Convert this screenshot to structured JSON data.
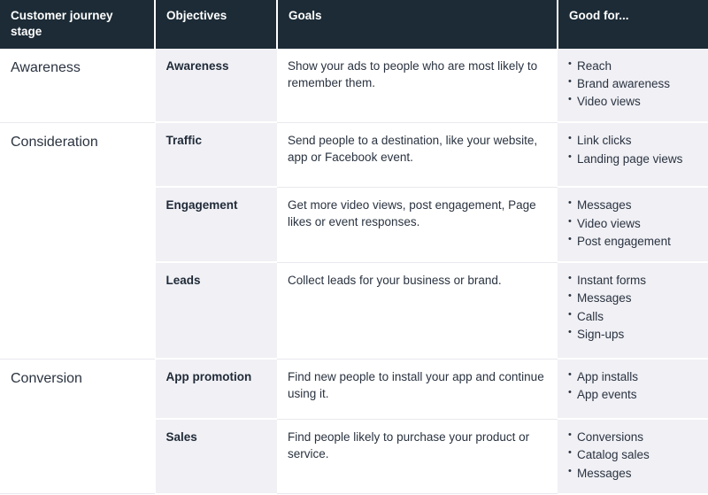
{
  "table": {
    "headers": [
      {
        "label": "Customer journey stage",
        "name": "header-customer-journey-stage"
      },
      {
        "label": "Objectives",
        "name": "header-objectives"
      },
      {
        "label": "Goals",
        "name": "header-goals"
      },
      {
        "label": "Good for...",
        "name": "header-good-for"
      }
    ],
    "colors": {
      "header_bg": "#1c2b36",
      "header_text": "#ffffff",
      "alt_column_bg": "#f0f0f5",
      "body_bg": "#ffffff",
      "body_text": "#2a3340",
      "row_rule": "#e8e8ef"
    },
    "rows": [
      {
        "stage": "Awareness",
        "stage_rowspan": 1,
        "objective": "Awareness",
        "goal": "Show your ads to people who are most likely to remember them.",
        "good_for": [
          "Reach",
          "Brand awareness",
          "Video views"
        ]
      },
      {
        "stage": "Consideration",
        "stage_rowspan": 3,
        "objective": "Traffic",
        "goal": "Send people to a destination, like your website, app or Facebook event.",
        "good_for": [
          "Link clicks",
          "Landing page views"
        ]
      },
      {
        "stage": "",
        "stage_rowspan": 0,
        "objective": "Engagement",
        "goal": "Get more video views, post engagement, Page likes or event responses.",
        "good_for": [
          "Messages",
          "Video views",
          "Post engagement"
        ]
      },
      {
        "stage": "",
        "stage_rowspan": 0,
        "objective": "Leads",
        "goal": "Collect leads for your business or brand.",
        "good_for": [
          "Instant forms",
          "Messages",
          "Calls",
          "Sign-ups"
        ]
      },
      {
        "stage": "Conversion",
        "stage_rowspan": 2,
        "objective": "App promotion",
        "goal": "Find new people to install your app and continue using it.",
        "good_for": [
          "App installs",
          "App events"
        ]
      },
      {
        "stage": "",
        "stage_rowspan": 0,
        "objective": "Sales",
        "goal": "Find people likely to purchase your product or service.",
        "good_for": [
          "Conversions",
          "Catalog sales",
          "Messages"
        ]
      }
    ]
  }
}
